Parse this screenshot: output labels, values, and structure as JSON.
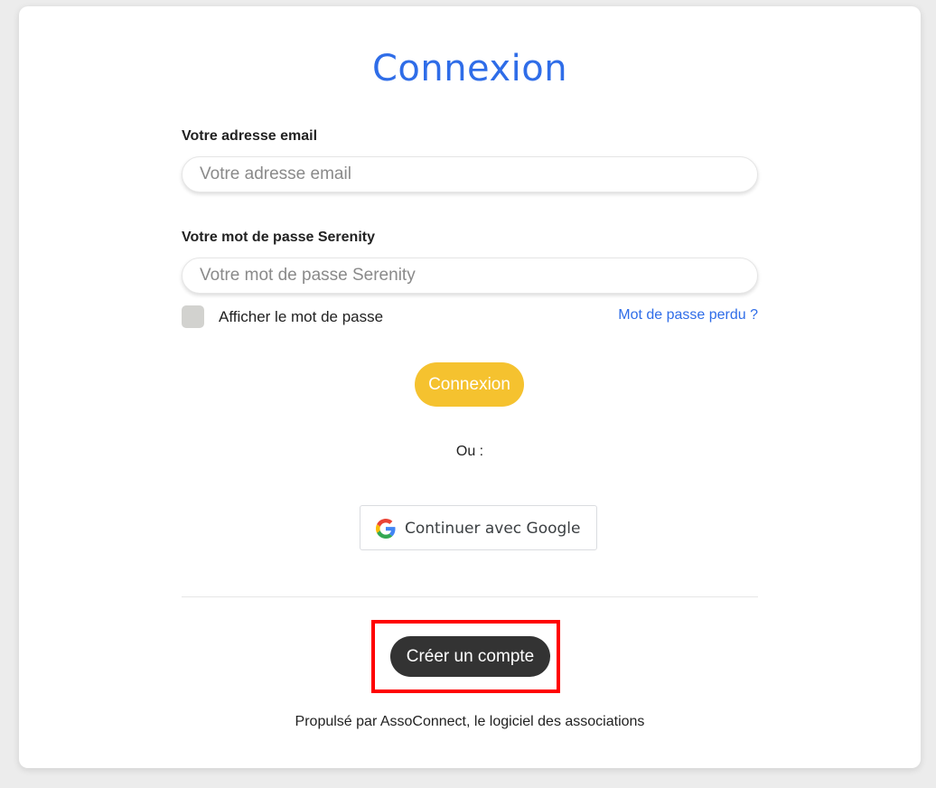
{
  "title": "Connexion",
  "email": {
    "label": "Votre adresse email",
    "placeholder": "Votre adresse email",
    "value": ""
  },
  "password": {
    "label": "Votre mot de passe Serenity",
    "placeholder": "Votre mot de passe Serenity",
    "value": ""
  },
  "show_password": {
    "label": "Afficher le mot de passe",
    "checked": false
  },
  "forgot_password": "Mot de passe perdu ?",
  "login_button": "Connexion",
  "or_text": "Ou :",
  "google_button": {
    "label": "Continuer avec Google",
    "icon": "google-icon"
  },
  "create_account_button": "Créer un compte",
  "footer": "Propulsé par AssoConnect, le logiciel des associations",
  "colors": {
    "title": "#2f6de8",
    "login_button": "#f5c22f",
    "create_button": "#333333",
    "highlight": "#ff0000"
  }
}
